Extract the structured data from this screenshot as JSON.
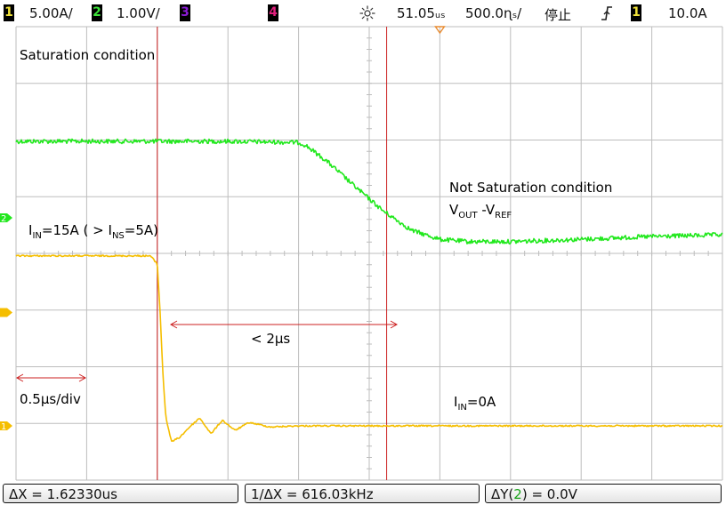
{
  "header": {
    "ch1_badge": "1",
    "ch1_scale": "5.00A/",
    "ch2_badge": "2",
    "ch2_scale": "1.00V/",
    "ch3_badge": "3",
    "ch4_badge": "4",
    "time_delay": "51.05ᵤₛ",
    "time_scale": "500.0ɳₛ/",
    "run_state": "停止",
    "trigger_icon": "trigger-slope-icon",
    "trig_badge": "1",
    "trig_level": "10.0A"
  },
  "colors": {
    "background": "#ffffff",
    "grid": "#bdbdbd",
    "ch1": "#f5be00",
    "ch2": "#22e81e",
    "ch3": "#8a1bd6",
    "ch4": "#e0207d",
    "cursor": "#cc2020",
    "marker": "#e88b30",
    "ch1_badge_text": "#f0e23a",
    "ch2_badge_text": "#3de23a"
  },
  "chart_data": {
    "type": "line",
    "x_unit": "us",
    "xlim": [
      -1.0,
      4.0
    ],
    "x_divisions": 10,
    "y_divisions": 8,
    "grid": true,
    "series": [
      {
        "channel": "2",
        "unit": "V",
        "scale_per_div": 1.0,
        "x": [
          -1.0,
          0.0,
          0.5,
          1.0,
          1.05,
          1.2,
          1.4,
          1.6,
          1.8,
          2.0,
          2.2,
          2.5,
          3.0,
          3.5,
          4.0
        ],
        "y": [
          1.35,
          1.35,
          1.35,
          1.33,
          1.28,
          1.0,
          0.55,
          0.12,
          -0.22,
          -0.38,
          -0.42,
          -0.42,
          -0.38,
          -0.33,
          -0.3
        ]
      },
      {
        "channel": "1",
        "unit": "A",
        "scale_per_div": 5.0,
        "x": [
          -1.0,
          -0.05,
          0.0,
          0.02,
          0.04,
          0.06,
          0.1,
          0.16,
          0.22,
          0.3,
          0.38,
          0.46,
          0.55,
          0.65,
          0.8,
          1.0,
          1.5,
          2.0,
          3.0,
          4.0
        ],
        "y": [
          15.0,
          15.0,
          14.3,
          10.0,
          4.5,
          0.8,
          -1.4,
          -1.0,
          -0.2,
          0.7,
          -0.7,
          0.5,
          -0.4,
          0.3,
          -0.1,
          0.0,
          0.0,
          0.0,
          0.0,
          0.0
        ]
      }
    ],
    "cursors_x": [
      0.0,
      1.6233
    ],
    "annotations": {
      "saturation": "Saturation condition",
      "not_saturation": "Not Saturation condition",
      "vout_a": "V",
      "vout_a_sub": "OUT",
      "vout_b": " -V",
      "vout_b_sub": "REF",
      "iin_high_a": "I",
      "iin_high_a_sub": "IN",
      "iin_high_b": "=15A ( > I",
      "iin_high_b_sub": "NS",
      "iin_high_c": "=5A)",
      "delay": "< 2μs",
      "timebase": "0.5μs/div",
      "iin_low_a": "I",
      "iin_low_a_sub": "IN",
      "iin_low_b": "=0A"
    }
  },
  "status": {
    "delta_x": "ΔX = 1.62330us",
    "inv_delta_x": "1/ΔX = 616.03kHz",
    "delta_y_prefix": "ΔY(",
    "delta_y_ch": "2",
    "delta_y_suffix": ") = 0.0V"
  }
}
